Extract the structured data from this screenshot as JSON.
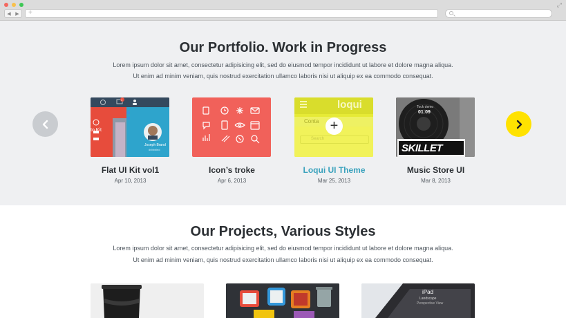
{
  "browser": {
    "expand_glyph": "⤢"
  },
  "portfolio": {
    "title": "Our Portfolio. Work in Progress",
    "text_line1": "Lorem ipsum dolor sit amet, consectetur adipisicing elit, sed do eiusmod tempor incididunt ut labore et dolore magna aliqua.",
    "text_line2": "Ut enim ad minim veniam, quis nostrud exercitation ullamco laboris nisi ut aliquip ex ea commodo consequat.",
    "items": [
      {
        "title": "Flat UI Kit vol1",
        "date": "Apr 10, 2013",
        "thumb_caption": "Joseph Brand",
        "thumb_sub": "dribbbled",
        "thumb_badge": "4",
        "thumb_side": "to Kit"
      },
      {
        "title": "Icon’s troke",
        "date": "Apr 6, 2013"
      },
      {
        "title": "Loqui UI Theme",
        "date": "Mar 25, 2013",
        "thumb_logo": "loqui",
        "thumb_tab": "Conta",
        "thumb_search": "Search",
        "overlay_icon": "+"
      },
      {
        "title": "Music Store UI",
        "date": "Mar 8, 2013",
        "thumb_line1": "Tock demo",
        "thumb_line2": "01:09",
        "thumb_brand": "SKILLET"
      }
    ]
  },
  "projects": {
    "title": "Our Projects, Various Styles",
    "text_line1": "Lorem ipsum dolor sit amet, consectetur adipisicing elit, sed do eiusmod tempor incididunt ut labore et dolore magna aliqua.",
    "text_line2": "Ut enim ad minim veniam, quis nostrud exercitation ullamco laboris nisi ut aliquip ex ea commodo consequat.",
    "ipad_label": "iPad",
    "ipad_sub": "Landscape",
    "ipad_sub2": "Perspective View"
  },
  "colors": {
    "accent_yellow": "#ffe200",
    "accent_teal": "#3aa2bd",
    "icon_card_red": "#f1615a",
    "loqui_yellow": "#eded3a",
    "section_bg": "#eff0f2"
  }
}
